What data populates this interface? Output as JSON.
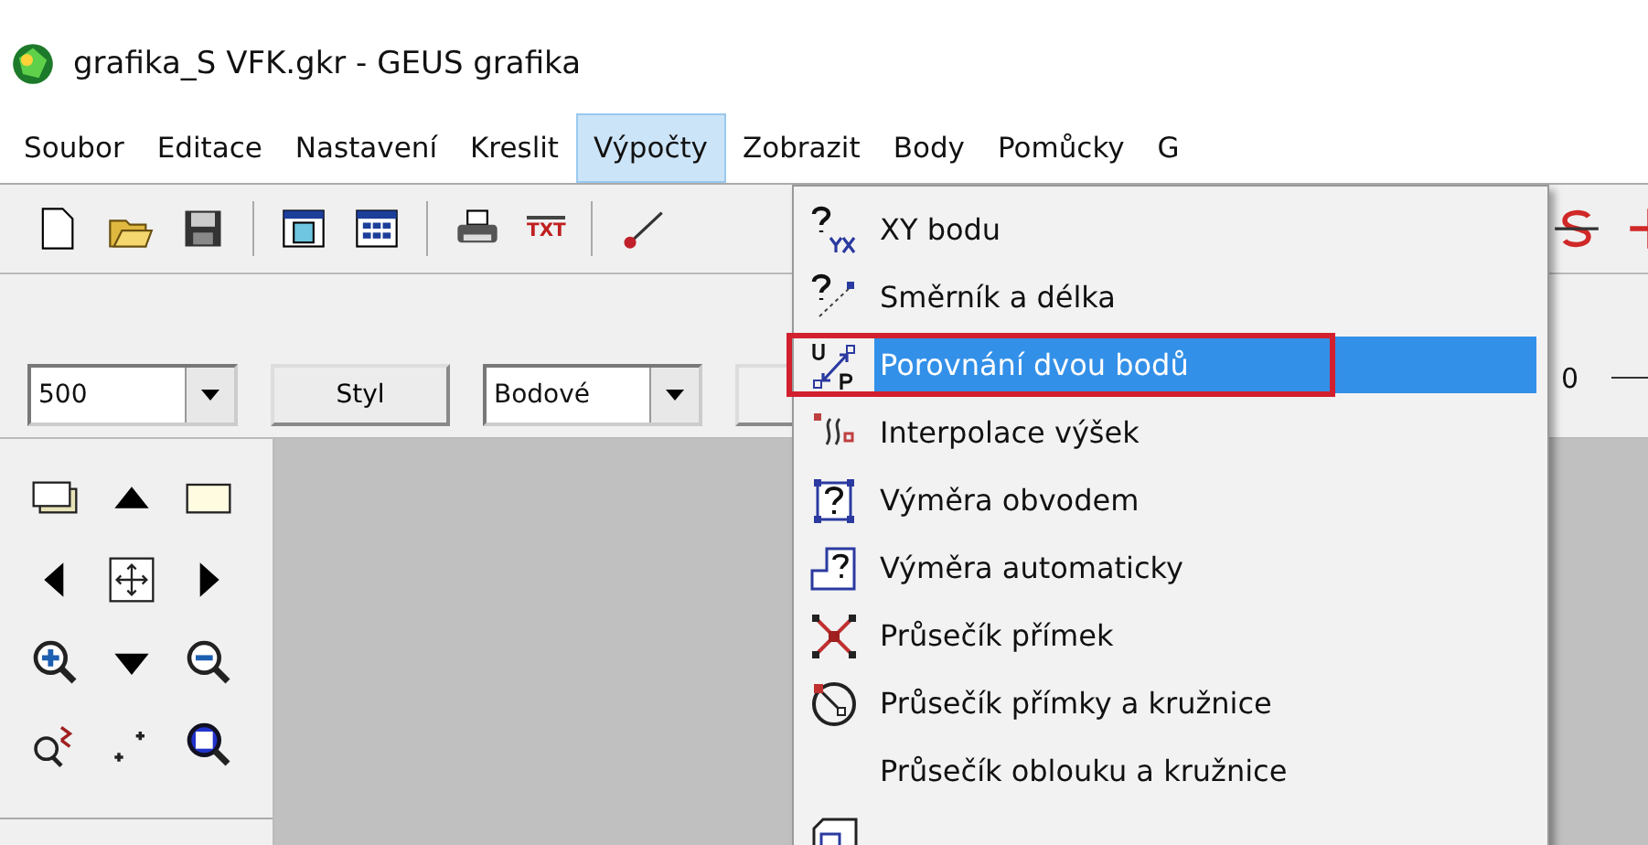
{
  "window": {
    "title": "grafika_S VFK.gkr - GEUS grafika"
  },
  "menu_bar": [
    {
      "label": "Soubor",
      "selected": false
    },
    {
      "label": "Editace",
      "selected": false
    },
    {
      "label": "Nastavení",
      "selected": false
    },
    {
      "label": "Kreslit",
      "selected": false
    },
    {
      "label": "Výpočty",
      "selected": true
    },
    {
      "label": "Zobrazit",
      "selected": false
    },
    {
      "label": "Body",
      "selected": false
    },
    {
      "label": "Pomůcky",
      "selected": false
    },
    {
      "label": "G",
      "selected": false
    }
  ],
  "toolbar": {
    "txt_label": "TXT"
  },
  "options_bar": {
    "scale": "500",
    "style_button": "Styl",
    "mode": "Bodové",
    "reading": "0"
  },
  "dropdown": {
    "items": [
      {
        "label": "XY bodu",
        "selected": false,
        "outlined": false
      },
      {
        "label": "Směrník a délka",
        "selected": false,
        "outlined": false
      },
      {
        "label": "Porovnání dvou bodů",
        "selected": true,
        "outlined": true
      },
      {
        "label": "Interpolace výšek",
        "selected": false,
        "outlined": false
      },
      {
        "label": "Výměra obvodem",
        "selected": false,
        "outlined": false
      },
      {
        "label": "Výměra automaticky",
        "selected": false,
        "outlined": false
      },
      {
        "label": "Průsečík přímek",
        "selected": false,
        "outlined": false
      },
      {
        "label": "Průsečík přímky a kružnice",
        "selected": false,
        "outlined": false
      },
      {
        "label": "Průsečík oblouku a kružnice",
        "selected": false,
        "outlined": false
      },
      {
        "selected": false,
        "outlined": false
      }
    ]
  }
}
